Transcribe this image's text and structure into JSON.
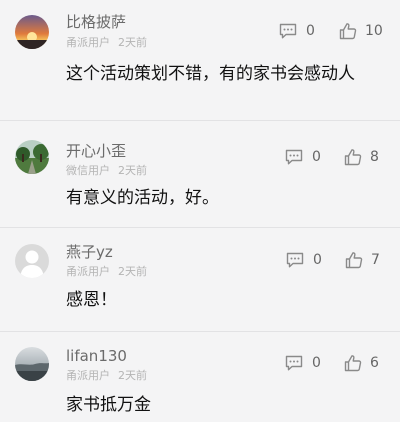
{
  "comments": [
    {
      "username": "比格披萨",
      "user_type": "甬派用户",
      "time": "2天前",
      "content": "这个活动策划不错，有的家书会感动人",
      "reply_count": "0",
      "like_count": "10",
      "avatar_icon": "sunset-avatar-icon"
    },
    {
      "username": "开心小歪",
      "user_type": "微信用户",
      "time": "2天前",
      "content": "有意义的活动，好。",
      "reply_count": "0",
      "like_count": "8",
      "avatar_icon": "park-avatar-icon"
    },
    {
      "username": "燕子yz",
      "user_type": "甬派用户",
      "time": "2天前",
      "content": "感恩！",
      "reply_count": "0",
      "like_count": "7",
      "avatar_icon": "default-avatar-icon"
    },
    {
      "username": "lifan130",
      "user_type": "甬派用户",
      "time": "2天前",
      "content": "家书抵万金",
      "reply_count": "0",
      "like_count": "6",
      "avatar_icon": "sea-avatar-icon"
    }
  ],
  "colors": {
    "background": "#f4f4f5",
    "username": "#6b6b6b",
    "meta": "#b4b4b4",
    "content": "#111111",
    "icon": "#8a8a8a"
  }
}
